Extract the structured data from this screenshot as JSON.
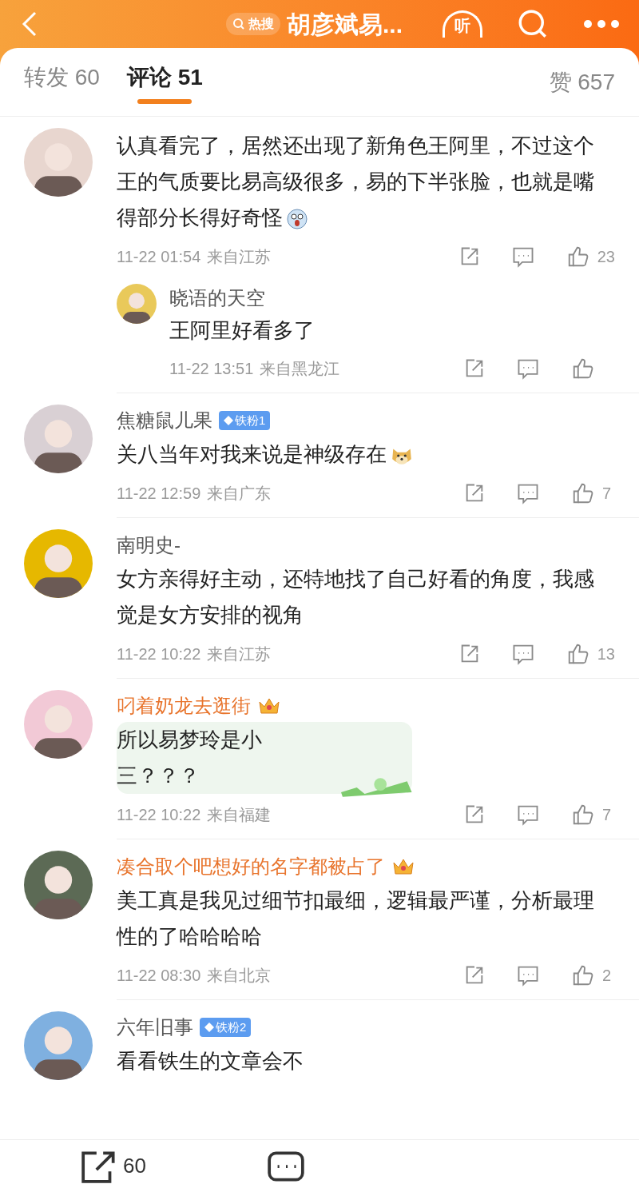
{
  "header": {
    "hot_tag": "热搜",
    "title": "胡彦斌易...",
    "listen": "听"
  },
  "tabs": [
    {
      "label": "转发 60",
      "selected": false
    },
    {
      "label": "评论 51",
      "selected": true
    }
  ],
  "likes_total": "赞 657",
  "comments": [
    {
      "text": "认真看完了，居然还出现了新角色王阿里，不过这个王的气质要比易高级很多，易的下半张脸，也就是嘴得部分长得好奇怪",
      "emoji": {
        "kind": "scared"
      },
      "time": "11-22 01:54",
      "location": "来自江苏",
      "likes": "23",
      "replies": [
        {
          "name": "晓语的天空",
          "text": "王阿里好看多了",
          "time": "11-22 13:51",
          "location": "来自黑龙江"
        }
      ]
    },
    {
      "name": "焦糖鼠儿果",
      "badge": "铁粉1",
      "text": "关八当年对我来说是神级存在",
      "emoji": {
        "kind": "doge"
      },
      "time": "11-22 12:59",
      "location": "来自广东",
      "likes": "7"
    },
    {
      "name": "南明史-",
      "text": "女方亲得好主动，还特地找了自己好看的角度，我感觉是女方安排的视角",
      "time": "11-22 10:22",
      "location": "来自江苏",
      "likes": "13"
    },
    {
      "name": "叼着奶龙去逛街",
      "vip": true,
      "bubble": true,
      "text": "所以易梦玲是小三？？？",
      "time": "11-22 10:22",
      "location": "来自福建",
      "likes": "7"
    },
    {
      "name": "凑合取个吧想好的名字都被占了",
      "vip": true,
      "text": "美工真是我见过细节扣最细，逻辑最严谨，分析最理性的了哈哈哈哈",
      "time": "11-22 08:30",
      "location": "来自北京",
      "likes": "2"
    },
    {
      "name": "六年旧事",
      "badge": "铁粉2",
      "text": "看看铁生的文章会不"
    }
  ],
  "bottom_bar": {
    "repost_count": "60"
  }
}
